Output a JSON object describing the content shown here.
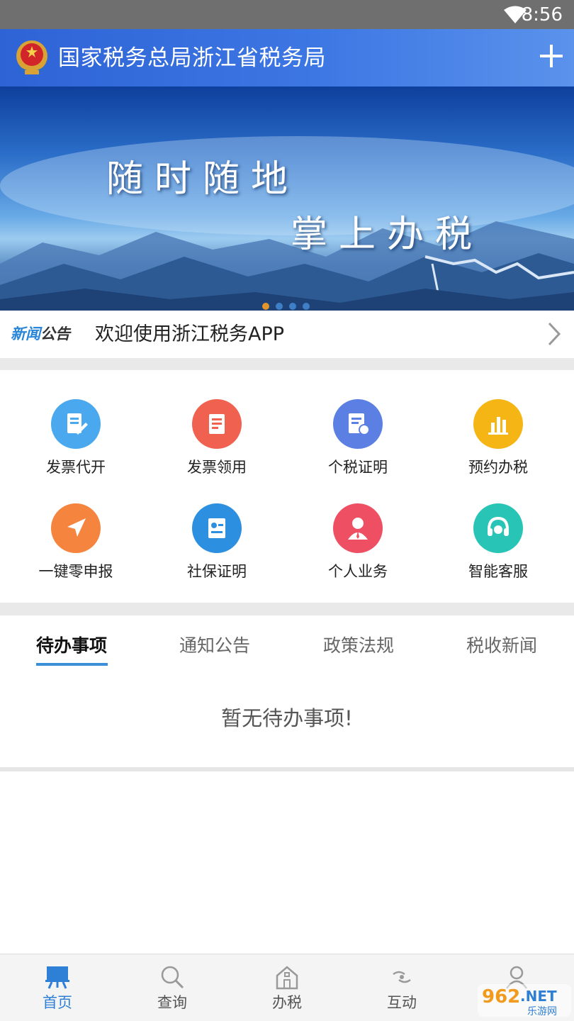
{
  "status_bar": {
    "time": "8:56"
  },
  "header": {
    "title": "国家税务总局浙江省税务局"
  },
  "banner": {
    "line1": "随时随地",
    "line2": "掌上办税",
    "dot_count": 4,
    "active_dot": 0
  },
  "news": {
    "tag_part1": "新闻",
    "tag_part2": "公告",
    "text": "欢迎使用浙江税务APP"
  },
  "services": [
    {
      "label": "发票代开",
      "icon": "invoice-issue-icon",
      "color": "#4aa8ee"
    },
    {
      "label": "发票领用",
      "icon": "invoice-receive-icon",
      "color": "#f0624f"
    },
    {
      "label": "个税证明",
      "icon": "tax-certificate-icon",
      "color": "#5b7fe2"
    },
    {
      "label": "预约办税",
      "icon": "appointment-chart-icon",
      "color": "#f4b515"
    },
    {
      "label": "一键零申报",
      "icon": "send-arrow-icon",
      "color": "#f4843e"
    },
    {
      "label": "社保证明",
      "icon": "social-security-card-icon",
      "color": "#2c8fe0"
    },
    {
      "label": "个人业务",
      "icon": "person-icon",
      "color": "#ee4f62"
    },
    {
      "label": "智能客服",
      "icon": "headset-icon",
      "color": "#28c4b5"
    }
  ],
  "tabs": [
    {
      "label": "待办事项",
      "active": true
    },
    {
      "label": "通知公告",
      "active": false
    },
    {
      "label": "政策法规",
      "active": false
    },
    {
      "label": "税收新闻",
      "active": false
    }
  ],
  "empty_message": "暂无待办事项!",
  "bottom_nav": [
    {
      "label": "首页",
      "icon": "home-easel-icon",
      "active": true
    },
    {
      "label": "查询",
      "icon": "search-icon",
      "active": false
    },
    {
      "label": "办税",
      "icon": "building-icon",
      "active": false
    },
    {
      "label": "互动",
      "icon": "interaction-icon",
      "active": false
    },
    {
      "label": "",
      "icon": "user-icon",
      "active": false
    }
  ],
  "watermark": {
    "text1": "962",
    "text2": ".NET",
    "text3": "乐游网"
  },
  "colors": {
    "header_blue": "#3d77e3",
    "accent": "#3a8fd8",
    "news_tag_blue": "#2a86d8",
    "dot_active": "#e0962a"
  }
}
